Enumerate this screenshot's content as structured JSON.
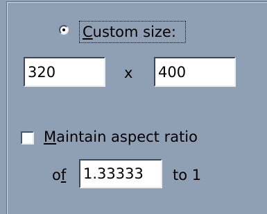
{
  "custom_size": {
    "label": "Custom size:",
    "selected": true
  },
  "dimensions": {
    "width_value": "320",
    "separator": "x",
    "height_value": "400"
  },
  "aspect_ratio": {
    "checkbox_label": "Maintain aspect ratio",
    "checked": false,
    "of_label": "of",
    "ratio_value": "1.33333",
    "to_label": "to 1"
  },
  "colors": {
    "panel_background": "#8fa0b5",
    "field_background": "#ffffff"
  }
}
